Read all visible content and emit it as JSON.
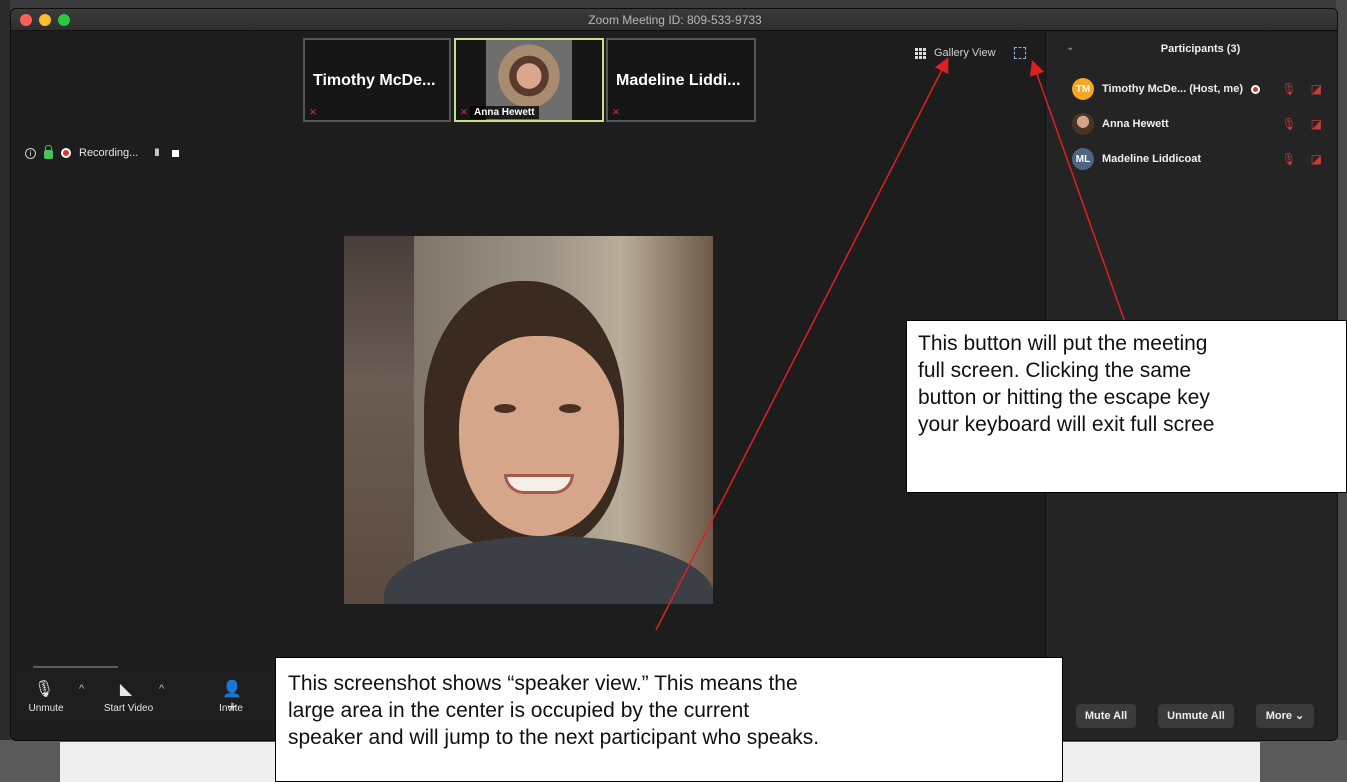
{
  "window": {
    "title": "Zoom Meeting ID: 809-533-9733"
  },
  "filmstrip": {
    "tiles": [
      {
        "name": "Timothy McDe...",
        "muted_icon": "mic-muted-icon"
      },
      {
        "name": "Anna Hewett",
        "muted_icon": "mic-muted-icon",
        "active": true
      },
      {
        "name": "Madeline Liddi...",
        "muted_icon": "mic-muted-icon"
      }
    ]
  },
  "view_controls": {
    "gallery_view_label": "Gallery View",
    "gallery_icon": "grid-icon",
    "fullscreen_icon": "fullscreen-icon"
  },
  "recording": {
    "status_text": "Recording...",
    "pause_glyph": "II"
  },
  "toolbar": {
    "unmute_label": "Unmute",
    "start_video_label": "Start Video",
    "invite_label": "Invite",
    "mic_glyph": "🎙",
    "video_glyph": "◣",
    "invite_glyph": "👤+",
    "caret_glyph": "^"
  },
  "participants_panel": {
    "title": "Participants (3)",
    "collapse_glyph": "⌄",
    "participants": [
      {
        "initials": "TM",
        "name": "Timothy McDe...  (Host, me)",
        "avatar_color": "#f5a623",
        "recording": true
      },
      {
        "initials": "",
        "name": "Anna Hewett",
        "avatar_color": "#8c6a58",
        "recording": false
      },
      {
        "initials": "ML",
        "name": "Madeline Liddicoat",
        "avatar_color": "#4d6583",
        "recording": false
      }
    ],
    "mic_status_glyph": "🎙",
    "video_status_glyph": "◪",
    "footer": {
      "mute_all_label": "Mute All",
      "unmute_all_label": "Unmute All",
      "more_label": "More ⌄"
    }
  },
  "annotations": {
    "right_callout": "This button will put the meeting\nfull screen. Clicking the same\nbutton or hitting the escape key\nyour keyboard will exit full scree",
    "bottom_callout": "This screenshot shows “speaker view.” This means the\nlarge area in the center is occupied by the current\nspeaker and will jump to the next participant who speaks."
  },
  "colors": {
    "accent_active_tile": "#c4e08a",
    "muted_red": "#e0312e",
    "annotation_arrow": "#e02020"
  }
}
